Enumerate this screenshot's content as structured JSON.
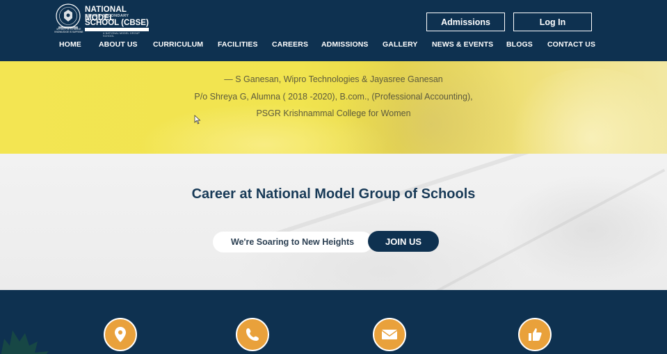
{
  "logo": {
    "line1": "NATIONAL MODEL",
    "line2": "SENIOR SECONDARY",
    "line3": "SCHOOL (CBSE)",
    "tagline": "A NATIONAL MODEL GROUP SCHOOL",
    "seal_top": "MY DUTY IS TO SERVE",
    "seal_bottom": "KNOWLEDGE IS SUPREME"
  },
  "header_buttons": {
    "admissions": "Admissions",
    "login": "Log In"
  },
  "nav": [
    "HOME",
    "ABOUT US",
    "CURRICULUM",
    "FACILITIES",
    "CAREERS",
    "ADMISSIONS",
    "GALLERY",
    "NEWS & EVENTS",
    "BLOGS",
    "CONTACT US"
  ],
  "testimonial": {
    "line1": "— S Ganesan, Wipro Technologies & Jayasree Ganesan",
    "line2": "P/o Shreya G, Alumna ( 2018 -2020), B.com., (Professional Accounting),",
    "line3": "PSGR Krishnammal College for Women"
  },
  "career": {
    "title": "Career at National Model Group of Schools",
    "pill_text": "We're Soaring to New Heights",
    "join_label": "JOIN US"
  },
  "contact_icons": [
    "location-pin-icon",
    "phone-icon",
    "envelope-icon",
    "thumbs-up-icon"
  ],
  "colors": {
    "navy": "#0e3150",
    "yellow": "#f3e552",
    "orange": "#e9a13b"
  }
}
